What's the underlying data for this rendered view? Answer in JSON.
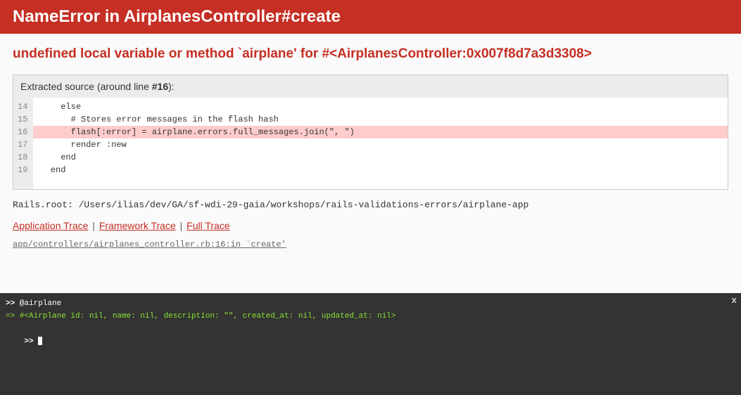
{
  "header": {
    "title": "NameError in AirplanesController#create"
  },
  "error": {
    "message": "undefined local variable or method `airplane' for #<AirplanesController:0x007f8d7a3d3308>"
  },
  "source": {
    "header_prefix": "Extracted source (around line ",
    "header_line": "#16",
    "header_suffix": "):",
    "highlight_index": 2,
    "lines": [
      {
        "num": "14",
        "code": "    else"
      },
      {
        "num": "15",
        "code": "      # Stores error messages in the flash hash"
      },
      {
        "num": "16",
        "code": "      flash[:error] = airplane.errors.full_messages.join(\", \")"
      },
      {
        "num": "17",
        "code": "      render :new"
      },
      {
        "num": "18",
        "code": "    end"
      },
      {
        "num": "19",
        "code": "  end"
      }
    ]
  },
  "rails_root": "Rails.root: /Users/ilias/dev/GA/sf-wdi-29-gaia/workshops/rails-validations-errors/airplane-app",
  "trace_links": {
    "application": "Application Trace",
    "framework": "Framework Trace",
    "full": "Full Trace",
    "sep": "|"
  },
  "trace_frame": "app/controllers/airplanes_controller.rb:16:in `create'",
  "console": {
    "prompt": ">>",
    "output_prefix": "=>",
    "entries": [
      {
        "input": "@airplane",
        "output": "#<Airplane id: nil, name: nil, description: \"\", created_at: nil, updated_at: nil>"
      }
    ]
  }
}
